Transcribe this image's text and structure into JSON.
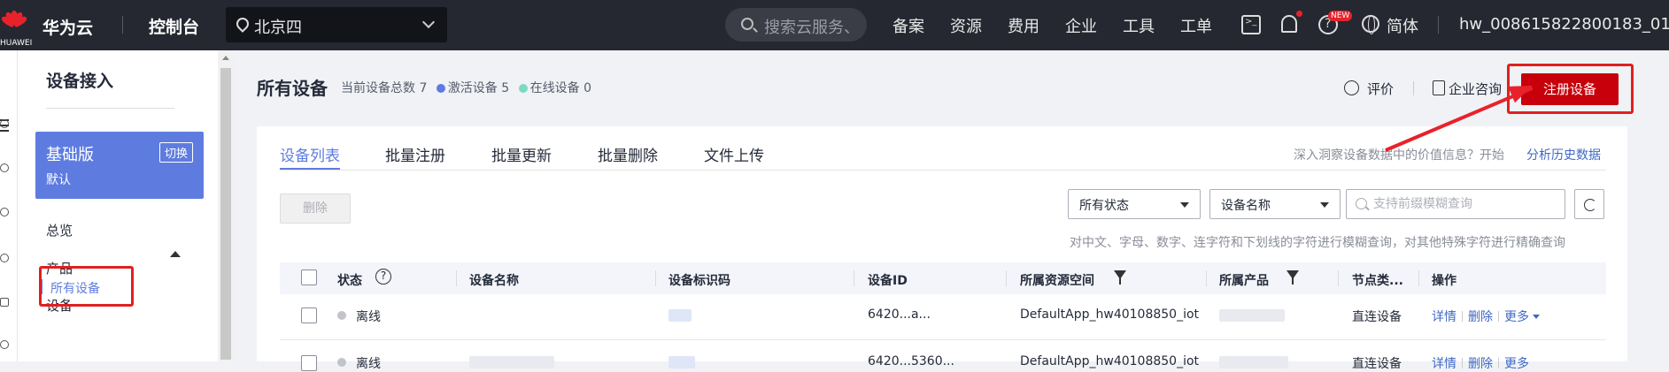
{
  "topbar": {
    "logo_text": "HUAWEI",
    "brand": "华为云",
    "console": "控制台",
    "region": "北京四",
    "search_placeholder": "搜索云服务、",
    "nav": [
      "备案",
      "资源",
      "费用",
      "企业",
      "工具",
      "工单"
    ],
    "new_badge": "NEW",
    "language": "简体",
    "username": "hw_008615822800183_01"
  },
  "sidebar": {
    "title": "设备接入",
    "edition": {
      "name": "基础版",
      "sub": "默认",
      "switch": "切换"
    },
    "items": [
      "总览",
      "产品",
      "设备"
    ],
    "active_item": "所有设备"
  },
  "header": {
    "title": "所有设备",
    "total_label": "当前设备总数 7",
    "active_label": "激活设备 5",
    "online_label": "在线设备 0",
    "rate_label": "评价",
    "consult_label": "企业咨询",
    "register_label": "注册设备"
  },
  "tabs": [
    "设备列表",
    "批量注册",
    "批量更新",
    "批量删除",
    "文件上传"
  ],
  "insight": {
    "text": "深入洞察设备数据中的价值信息？开始",
    "link": "分析历史数据"
  },
  "toolbar": {
    "delete_label": "删除",
    "status_select": "所有状态",
    "field_select": "设备名称",
    "query_placeholder": "支持前缀模糊查询",
    "hint": "对中文、字母、数字、连字符和下划线的字符进行模糊查询，对其他特殊字符进行精确查询"
  },
  "table": {
    "columns": [
      "状态",
      "设备名称",
      "设备标识码",
      "设备ID",
      "所属资源空间",
      "所属产品",
      "节点类...",
      "操作"
    ],
    "rows": [
      {
        "status": "离线",
        "device_id": "6420...a...",
        "space": "DefaultApp_hw40108850_iot",
        "node_type": "直连设备"
      },
      {
        "status": "离线",
        "device_id": "6420...5360...",
        "space": "DefaultApp_hw40108850_iot",
        "node_type": "直连设备"
      }
    ],
    "ops": {
      "detail": "详情",
      "delete": "删除",
      "more": "更多"
    }
  },
  "colors": {
    "accent": "#5e7ce0",
    "brand_red": "#c7000b",
    "link": "#3f68c4",
    "topbar": "#252830"
  }
}
